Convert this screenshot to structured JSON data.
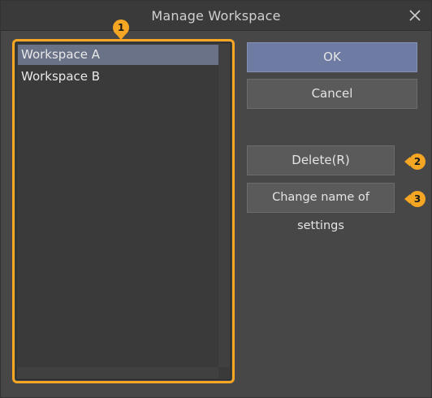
{
  "window": {
    "title": "Manage Workspace",
    "close_icon": "close-icon"
  },
  "workspace_list": {
    "items": [
      {
        "label": "Workspace A",
        "selected": true
      },
      {
        "label": "Workspace B",
        "selected": false
      }
    ]
  },
  "buttons": {
    "ok_label": "OK",
    "cancel_label": "Cancel",
    "delete_label": "Delete(R)",
    "rename_label": "Change name of settings"
  },
  "callouts": {
    "list": "1",
    "delete": "2",
    "rename": "3"
  },
  "colors": {
    "background": "#474747",
    "highlight_outline": "#f5a623",
    "selection": "#6a7288",
    "primary_button": "#6e7ca3"
  }
}
